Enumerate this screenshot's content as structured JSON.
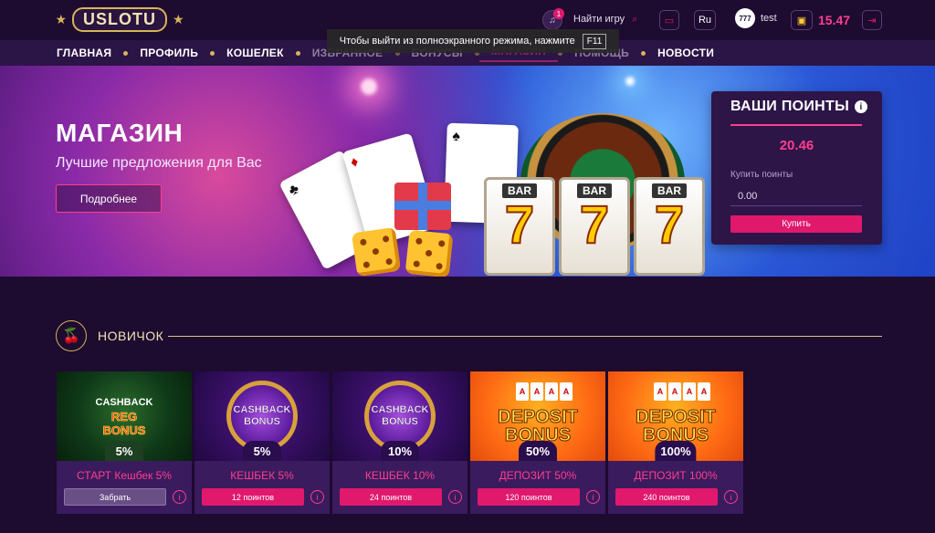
{
  "header": {
    "logo_text": "SLOT",
    "logo_star": "★",
    "notifications_count": "1",
    "search_label": "Найти игру",
    "search_icon": "⌕",
    "chat_icon": "▭",
    "language": "Ru",
    "avatar_text": "777",
    "username": "test",
    "wallet_icon": "▣",
    "balance": "15.47",
    "logout_icon": "⇥"
  },
  "nav": {
    "items": [
      "ГЛАВНАЯ",
      "ПРОФИЛЬ",
      "КОШЕЛЕК",
      "ИЗБРАННОЕ",
      "БОНУСЫ",
      "МАГАЗИН",
      "ПОМОЩЬ",
      "НОВОСТИ"
    ],
    "active": "МАГАЗИН"
  },
  "fullscreen_toast": {
    "text": "Чтобы выйти из полноэкранного режима, нажмите",
    "key": "F11"
  },
  "hero": {
    "title": "МАГАЗИН",
    "subtitle": "Лучшие предложения для Вас",
    "more_button": "Подробнее",
    "slot_word": "BAR",
    "slot_symbol": "7"
  },
  "points": {
    "title": "ВАШИ ПОИНТЫ",
    "info_icon": "i",
    "value": "20.46",
    "buy_label": "Купить поинты",
    "input_value": "0.00",
    "buy_button": "Купить"
  },
  "section": {
    "title": "НОВИЧОК",
    "icon": "cherries-icon"
  },
  "bonuses": [
    {
      "art_top": "CASHBACK",
      "art_mid": "REG",
      "art_bottom": "BONUS",
      "pct": "5%",
      "name": "СТАРТ Кешбек 5%",
      "button": "Забрать"
    },
    {
      "art_top": "CASHBACK",
      "art_bottom": "BONUS",
      "pct": "5%",
      "name": "КЕШБЕК 5%",
      "button": "12 поинтов"
    },
    {
      "art_top": "CASHBACK",
      "art_bottom": "BONUS",
      "pct": "10%",
      "name": "КЕШБЕК 10%",
      "button": "24 поинтов"
    },
    {
      "art_top": "DEPOSIT",
      "art_bottom": "BONUS",
      "pct": "50%",
      "name": "ДЕПОЗИТ 50%",
      "button": "120 поинтов"
    },
    {
      "art_top": "DEPOSIT",
      "art_bottom": "BONUS",
      "pct": "100%",
      "name": "ДЕПОЗИТ 100%",
      "button": "240 поинтов"
    }
  ],
  "colors": {
    "background": "#1d0b30",
    "accent": "#e0196d",
    "gold": "#d8b45a",
    "panel": "#2d1548"
  }
}
